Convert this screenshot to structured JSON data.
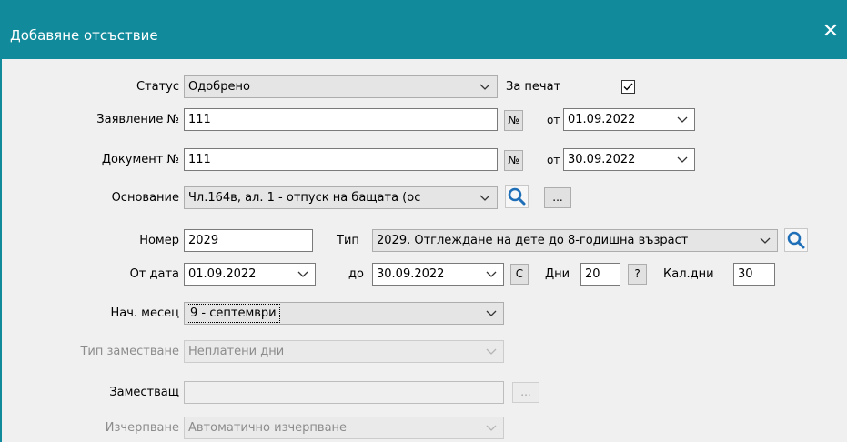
{
  "dialog": {
    "title": "Добавяне отсъствие",
    "close_glyph": "✕"
  },
  "status": {
    "label": "Статус",
    "value": "Одобрено"
  },
  "print": {
    "label": "За печат",
    "checked": true
  },
  "application": {
    "label": "Заявление №",
    "value": "111",
    "num_button": "№",
    "from_label": "от",
    "date": "01.09.2022"
  },
  "document": {
    "label": "Документ №",
    "value": "111",
    "num_button": "№",
    "from_label": "от",
    "date": "30.09.2022"
  },
  "basis": {
    "label": "Основание",
    "value": "Чл.164в, ал. 1 - отпуск на бащата (ос",
    "more_button": "..."
  },
  "number": {
    "label": "Номер",
    "value": "2029",
    "type_label": "Тип",
    "type_value": "2029.  Отглеждане на дете до 8-годишна възраст"
  },
  "dates": {
    "from_label": "От дата",
    "from_value": "01.09.2022",
    "to_label": "до",
    "to_value": "30.09.2022",
    "c_button": "C",
    "days_label": "Дни",
    "days_value": "20",
    "help_button": "?",
    "cal_label": "Кал.дни",
    "cal_value": "30"
  },
  "start_month": {
    "label": "Нач. месец",
    "value": "9 - септември"
  },
  "substitution_type": {
    "label": "Тип заместване",
    "value": "Неплатени дни"
  },
  "substitute": {
    "label": "Заместващ",
    "value": "",
    "more_button": "..."
  },
  "exhaustion": {
    "label": "Изчерпване",
    "value": "Автоматично изчерпване"
  }
}
